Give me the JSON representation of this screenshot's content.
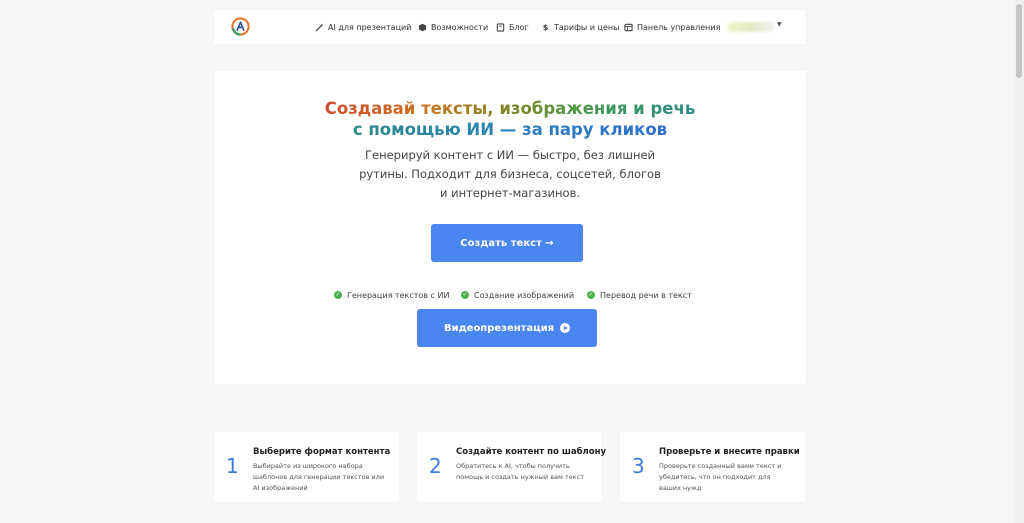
{
  "nav": {
    "items": [
      {
        "label": "AI для презентаций",
        "icon": "magic-wand-icon"
      },
      {
        "label": "Возможности",
        "icon": "box-icon"
      },
      {
        "label": "Блог",
        "icon": "book-icon"
      },
      {
        "label": "Тарифы и цены",
        "icon": "dollar-icon"
      },
      {
        "label": "Панель управления",
        "icon": "grid-icon"
      }
    ]
  },
  "hero": {
    "title_line1": "Создавай тексты, изображения и речь",
    "title_line2": "с помощью ИИ — за пару кликов",
    "subtitle": "Генерируй контент с ИИ — быстро, без лишней рутины. Подходит для бизнеса, соцсетей, блогов и интернет-магазинов.",
    "create_button": "Создать текст →",
    "video_button": "Видеопрезентация",
    "features": [
      "Генерация текстов с ИИ",
      "Создание изображений",
      "Перевод речи в текст"
    ]
  },
  "steps": [
    {
      "number": "1",
      "title": "Выберите формат контента",
      "desc": "Выбирайте из широкого набора шаблонов для генерации текстов или AI изображений"
    },
    {
      "number": "2",
      "title": "Создайте контент по шаблону",
      "desc": "Обратитесь к AI, чтобы получить помощь и создать нужный вам текст"
    },
    {
      "number": "3",
      "title": "Проверьте и внесите правки",
      "desc": "Проверьте созданный вами текст и убедитесь, что он подходит для ваших нужд"
    }
  ],
  "colors": {
    "accent": "#4a86ef",
    "check": "#4caf50",
    "step_number": "#3b7be0"
  }
}
